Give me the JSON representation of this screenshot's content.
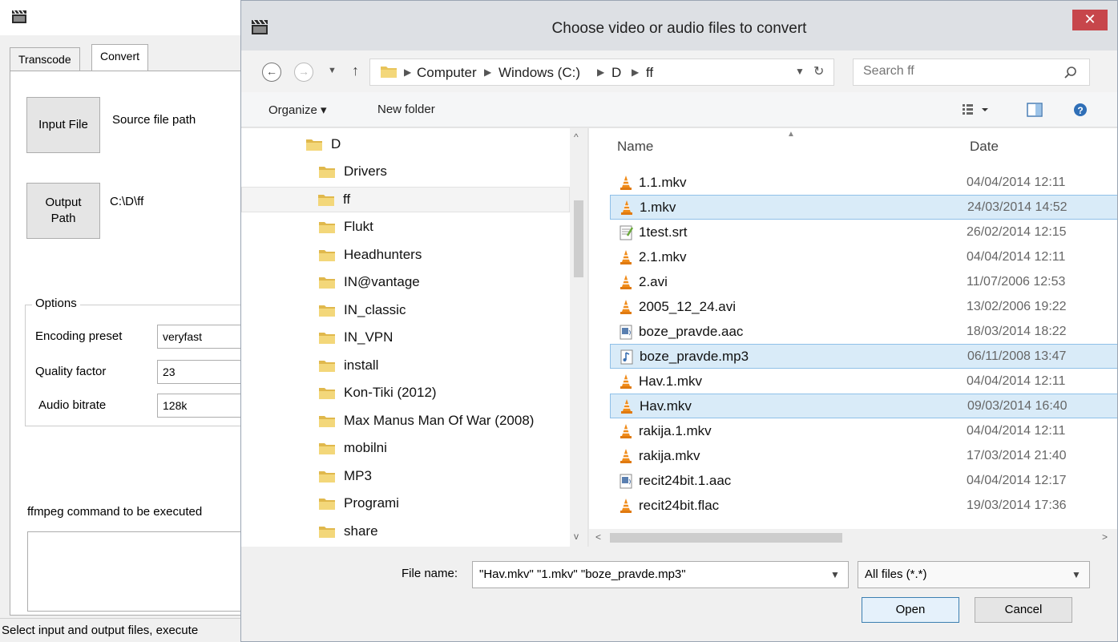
{
  "app": {
    "tabs": [
      {
        "label": "Transcode"
      },
      {
        "label": "Convert"
      }
    ],
    "input_file_button": "Input File",
    "source_path": "Source file path",
    "output_path_button": "Output Path",
    "output_path_value": "C:\\D\\ff",
    "options_title": "Options",
    "encoding_preset_label": "Encoding preset",
    "encoding_preset_value": "veryfast",
    "quality_factor_label": "Quality factor",
    "quality_factor_value": "23",
    "audio_bitrate_label": "Audio bitrate",
    "audio_bitrate_value": "128k",
    "command_label": "ffmpeg command to be executed",
    "status": "Select input and output files, execute"
  },
  "dialog": {
    "title": "Choose video or audio files to convert",
    "close_glyph": "✕",
    "breadcrumbs": [
      "Computer",
      "Windows (C:)",
      "D",
      "ff"
    ],
    "search_placeholder": "Search ff",
    "organize_label": "Organize ▾",
    "new_folder_label": "New folder",
    "tree_root": "D",
    "tree_items": [
      {
        "label": "Drivers"
      },
      {
        "label": "ff"
      },
      {
        "label": "Flukt"
      },
      {
        "label": "Headhunters"
      },
      {
        "label": "IN@vantage"
      },
      {
        "label": "IN_classic"
      },
      {
        "label": "IN_VPN"
      },
      {
        "label": "install"
      },
      {
        "label": "Kon-Tiki (2012)"
      },
      {
        "label": "Max Manus Man Of War (2008)"
      },
      {
        "label": "mobilni"
      },
      {
        "label": "MP3"
      },
      {
        "label": "Programi"
      },
      {
        "label": "share"
      }
    ],
    "columns": {
      "name": "Name",
      "date": "Date"
    },
    "files": [
      {
        "name": "1.1.mkv",
        "date": "04/04/2014 12:11",
        "icon": "vlc-cone-icon",
        "selected": false
      },
      {
        "name": "1.mkv",
        "date": "24/03/2014 14:52",
        "icon": "vlc-cone-icon",
        "selected": true
      },
      {
        "name": "1test.srt",
        "date": "26/02/2014 12:15",
        "icon": "text-file-icon",
        "selected": false
      },
      {
        "name": "2.1.mkv",
        "date": "04/04/2014 12:11",
        "icon": "vlc-cone-icon",
        "selected": false
      },
      {
        "name": "2.avi",
        "date": "11/07/2006 12:53",
        "icon": "vlc-cone-icon",
        "selected": false
      },
      {
        "name": "2005_12_24.avi",
        "date": "13/02/2006 19:22",
        "icon": "vlc-cone-icon",
        "selected": false
      },
      {
        "name": "boze_pravde.aac",
        "date": "18/03/2014 18:22",
        "icon": "audio-file-icon",
        "selected": false
      },
      {
        "name": "boze_pravde.mp3",
        "date": "06/11/2008 13:47",
        "icon": "music-file-icon",
        "selected": true
      },
      {
        "name": "Hav.1.mkv",
        "date": "04/04/2014 12:11",
        "icon": "vlc-cone-icon",
        "selected": false
      },
      {
        "name": "Hav.mkv",
        "date": "09/03/2014 16:40",
        "icon": "vlc-cone-icon",
        "selected": true
      },
      {
        "name": "rakija.1.mkv",
        "date": "04/04/2014 12:11",
        "icon": "vlc-cone-icon",
        "selected": false
      },
      {
        "name": "rakija.mkv",
        "date": "17/03/2014 21:40",
        "icon": "vlc-cone-icon",
        "selected": false
      },
      {
        "name": "recit24bit.1.aac",
        "date": "04/04/2014 12:17",
        "icon": "audio-file-icon",
        "selected": false
      },
      {
        "name": "recit24bit.flac",
        "date": "19/03/2014 17:36",
        "icon": "vlc-cone-icon",
        "selected": false
      }
    ],
    "file_name_label": "File name:",
    "file_name_value": "\"Hav.mkv\" \"1.mkv\" \"boze_pravde.mp3\"",
    "filter_value": "All files (*.*)",
    "open_label": "Open",
    "cancel_label": "Cancel"
  },
  "colors": {
    "selection": "#d9ebf8",
    "selection_border": "#8fc0e8",
    "close": "#c7464b",
    "folder": "#e8c45a"
  }
}
